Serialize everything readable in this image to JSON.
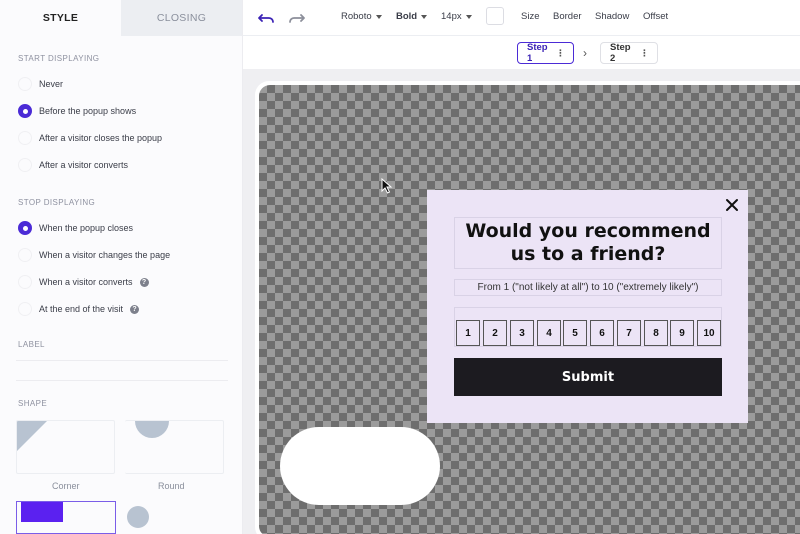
{
  "tabs": {
    "style": "STYLE",
    "closing": "CLOSING"
  },
  "start_displaying": {
    "title": "START DISPLAYING",
    "options": [
      "Never",
      "Before the popup shows",
      "After a visitor closes the popup",
      "After a visitor converts"
    ],
    "selected": "Before the popup shows"
  },
  "stop_displaying": {
    "title": "STOP DISPLAYING",
    "options": [
      "When the popup closes",
      "When a visitor changes the page",
      "When a visitor converts",
      "At the end of the visit"
    ],
    "selected": "When the popup closes",
    "help_mark": "?"
  },
  "label_section": {
    "title": "LABEL"
  },
  "shape_section": {
    "title": "SHAPE",
    "corner": "Corner",
    "round": "Round"
  },
  "toolbar": {
    "font": "Roboto",
    "weight": "Bold",
    "size": "14px",
    "size_btn": "Size",
    "border_btn": "Border",
    "shadow_btn": "Shadow",
    "offset_btn": "Offset",
    "undo_icon": "undo-icon",
    "redo_icon": "redo-icon"
  },
  "steps": {
    "step1": "Step 1",
    "step2": "Step 2",
    "more": "⋮"
  },
  "popup": {
    "headline": "Would you recommend us to a friend?",
    "subline": "From 1 (\"not likely at all\") to 10 (\"extremely likely\")",
    "scale": [
      "1",
      "2",
      "3",
      "4",
      "5",
      "6",
      "7",
      "8",
      "9",
      "10"
    ],
    "submit": "Submit"
  },
  "colors": {
    "accent": "#4b2bd6",
    "popup_bg": "#ece4f6",
    "submit_bg": "#1c1b20"
  }
}
